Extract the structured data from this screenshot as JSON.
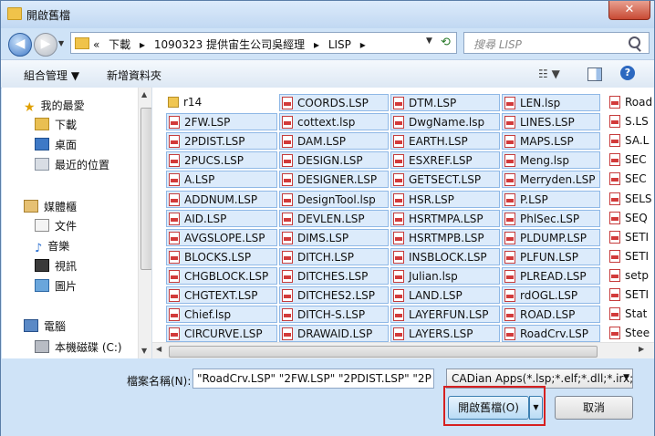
{
  "window": {
    "title": "開啟舊檔",
    "close_glyph": "✕"
  },
  "nav": {
    "back_glyph": "◀",
    "forward_glyph": "▶",
    "history_glyph": "▼"
  },
  "address": {
    "overflow": "«",
    "crumbs": [
      "下載",
      "▸",
      "1090323 提供宙生公司吳經理",
      "▸",
      "LISP",
      "▸"
    ],
    "dropdown_glyph": "▼",
    "refresh_glyph": "⟲"
  },
  "search": {
    "placeholder": "搜尋 LISP"
  },
  "toolbar": {
    "organize": "組合管理 ▼",
    "new_folder": "新增資料夾",
    "view_glyph": "☷ ▼",
    "help": "?"
  },
  "navpane": {
    "items": [
      {
        "label": "我的最愛",
        "icon": "star-icon"
      },
      {
        "label": "下載",
        "icon": "download-folder-icon"
      },
      {
        "label": "桌面",
        "icon": "desktop-icon"
      },
      {
        "label": "最近的位置",
        "icon": "recent-places-icon"
      },
      {
        "label": "媒體櫃",
        "icon": "library-icon"
      },
      {
        "label": "文件",
        "icon": "documents-icon"
      },
      {
        "label": "音樂",
        "icon": "music-icon"
      },
      {
        "label": "視訊",
        "icon": "video-icon"
      },
      {
        "label": "圖片",
        "icon": "pictures-icon"
      },
      {
        "label": "電腦",
        "icon": "computer-icon"
      },
      {
        "label": "本機磁碟 (C:)",
        "icon": "disk-icon"
      }
    ]
  },
  "files": {
    "col1": [
      "r14",
      "2FW.LSP",
      "2PDIST.LSP",
      "2PUCS.LSP",
      "A.LSP",
      "ADDNUM.LSP",
      "AID.LSP",
      "AVGSLOPE.LSP",
      "BLOCKS.LSP",
      "CHGBLOCK.LSP",
      "CHGTEXT.LSP",
      "Chief.lsp",
      "CIRCURVE.LSP"
    ],
    "col2": [
      "COORDS.LSP",
      "cottext.lsp",
      "DAM.LSP",
      "DESIGN.LSP",
      "DESIGNER.LSP",
      "DesignTool.lsp",
      "DEVLEN.LSP",
      "DIMS.LSP",
      "DITCH.LSP",
      "DITCHES.LSP",
      "DITCHES2.LSP",
      "DITCH-S.LSP",
      "DRAWAID.LSP"
    ],
    "col3": [
      "DTM.LSP",
      "DwgName.lsp",
      "EARTH.LSP",
      "ESXREF.LSP",
      "GETSECT.LSP",
      "HSR.LSP",
      "HSRTMPA.LSP",
      "HSRTMPB.LSP",
      "INSBLOCK.LSP",
      "Julian.lsp",
      "LAND.LSP",
      "LAYERFUN.LSP",
      "LAYERS.LSP"
    ],
    "col4": [
      "LEN.lsp",
      "LINES.LSP",
      "MAPS.LSP",
      "Meng.lsp",
      "Merryden.LSP",
      "P.LSP",
      "PhlSec.LSP",
      "PLDUMP.LSP",
      "PLFUN.LSP",
      "PLREAD.LSP",
      "rdOGL.LSP",
      "ROAD.LSP",
      "RoadCrv.LSP"
    ],
    "col5": [
      "Road",
      "S.LS",
      "SA.L",
      "SEC",
      "SEC",
      "SELS",
      "SEQ",
      "SETI",
      "SETI",
      "setp",
      "SETI",
      "Stat",
      "Stee"
    ]
  },
  "filename": {
    "label": "檔案名稱(N):",
    "value": "\"RoadCrv.LSP\" \"2FW.LSP\" \"2PDIST.LSP\" \"2P"
  },
  "filetype": {
    "value": "CADian Apps(*.lsp;*.elf;*.dll;*.irx;*",
    "arrow": "▼"
  },
  "buttons": {
    "open": "開啟舊檔(O)",
    "open_drop": "▼",
    "cancel": "取消"
  },
  "scroll": {
    "up": "▲",
    "down": "▼",
    "left": "◀",
    "right": "▶"
  }
}
